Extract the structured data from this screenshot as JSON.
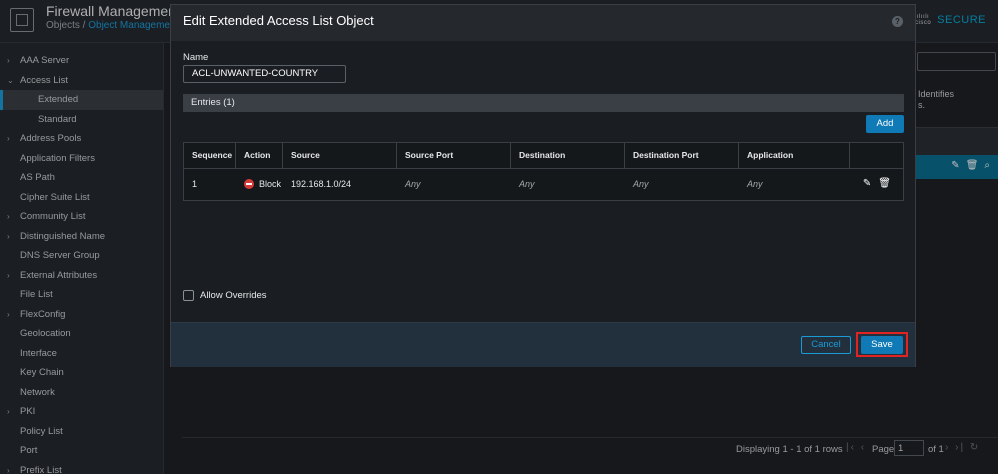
{
  "header": {
    "app_title": "Firewall Management",
    "breadcrumb_root": "Objects",
    "breadcrumb_sep": " / ",
    "breadcrumb_current": "Object Management",
    "brand_small": "cisco",
    "brand": "SECURE"
  },
  "sidebar": {
    "items": [
      {
        "label": "AAA Server",
        "chevron": "›"
      },
      {
        "label": "Access List",
        "chevron": "⌄"
      },
      {
        "label": "Extended",
        "chevron": ""
      },
      {
        "label": "Standard",
        "chevron": ""
      },
      {
        "label": "Address Pools",
        "chevron": "›"
      },
      {
        "label": "Application Filters",
        "chevron": ""
      },
      {
        "label": "AS Path",
        "chevron": ""
      },
      {
        "label": "Cipher Suite List",
        "chevron": ""
      },
      {
        "label": "Community List",
        "chevron": "›"
      },
      {
        "label": "Distinguished Name",
        "chevron": "›"
      },
      {
        "label": "DNS Server Group",
        "chevron": ""
      },
      {
        "label": "External Attributes",
        "chevron": "›"
      },
      {
        "label": "File List",
        "chevron": ""
      },
      {
        "label": "FlexConfig",
        "chevron": "›"
      },
      {
        "label": "Geolocation",
        "chevron": ""
      },
      {
        "label": "Interface",
        "chevron": ""
      },
      {
        "label": "Key Chain",
        "chevron": ""
      },
      {
        "label": "Network",
        "chevron": ""
      },
      {
        "label": "PKI",
        "chevron": "›"
      },
      {
        "label": "Policy List",
        "chevron": ""
      },
      {
        "label": "Port",
        "chevron": ""
      },
      {
        "label": "Prefix List",
        "chevron": "›"
      }
    ]
  },
  "background": {
    "desc_line1": "Identifies",
    "desc_line2": "s.",
    "pager": {
      "rows_text": "Displaying 1 - 1 of 1 rows",
      "page_label": "Page",
      "page_value": "1",
      "of_text": "of 1"
    }
  },
  "modal": {
    "title": "Edit Extended Access List Object",
    "name_label": "Name",
    "name_value": "ACL-UNWANTED-COUNTRY",
    "entries_label": "Entries (1)",
    "add_label": "Add",
    "columns": [
      "Sequence",
      "Action",
      "Source",
      "Source Port",
      "Destination",
      "Destination Port",
      "Application"
    ],
    "row": {
      "sequence": "1",
      "action": "Block",
      "source": "192.168.1.0/24",
      "source_port": "Any",
      "destination": "Any",
      "destination_port": "Any",
      "application": "Any"
    },
    "allow_overrides_label": "Allow Overrides",
    "allow_overrides_checked": false,
    "cancel_label": "Cancel",
    "save_label": "Save"
  },
  "colors": {
    "accent": "#0f7ab5",
    "link": "#1a9bd7",
    "highlight": "#e02424",
    "block": "#d63b3b"
  }
}
